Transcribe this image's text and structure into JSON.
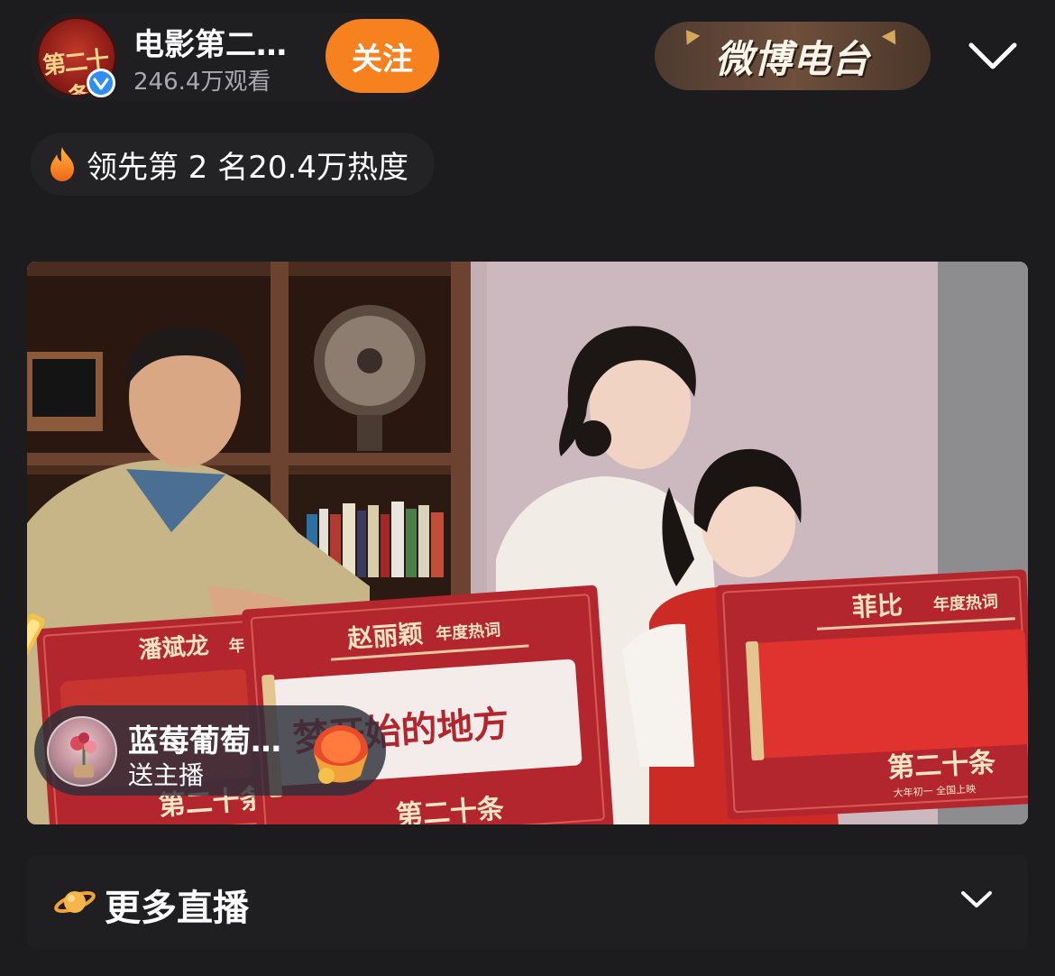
{
  "host": {
    "name": "电影第二…",
    "viewers": "246.4万观看",
    "follow_label": "关注",
    "avatar_text": "第二十条"
  },
  "badge": {
    "label": "微博电台"
  },
  "ranking": {
    "text": "领先第 2 名20.4万热度"
  },
  "video": {
    "signs": [
      {
        "name": "潘斌龙",
        "subtitle": "年"
      },
      {
        "name": "赵丽颖",
        "subtitle": "年度热词",
        "phrase": "梦开始的地方"
      },
      {
        "name": "菲比",
        "subtitle": "年度热词"
      }
    ],
    "movie_logo": "第二十条",
    "movie_tagline": "大年初一 全国上映"
  },
  "gift": {
    "user": "蓝莓葡萄…",
    "action": "送主播"
  },
  "more_live": {
    "label": "更多直播"
  },
  "colors": {
    "background": "#1c1c1e",
    "follow": "#f7801f",
    "verified": "#2f8ef4",
    "sign_red": "#b3262e",
    "radio_badge": "#5e4536"
  }
}
